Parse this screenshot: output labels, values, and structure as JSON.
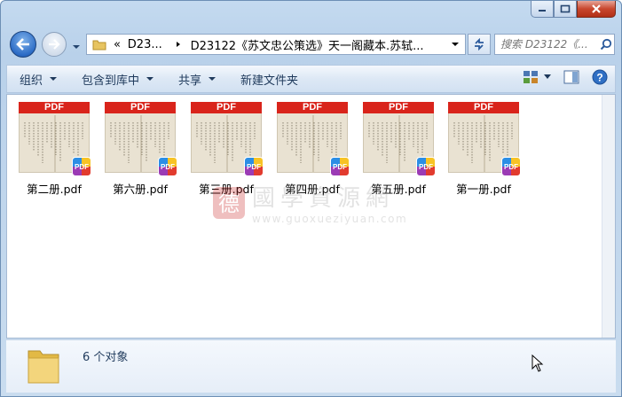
{
  "window": {
    "address_parts": [
      "«",
      "D23...",
      "D23122《苏文忠公策选》天一阁藏本.苏轼..."
    ],
    "search_placeholder": "搜索 D23122《...",
    "accent_color": "#2c6cc6"
  },
  "toolbar": {
    "organize": "组织",
    "include_library": "包含到库中",
    "share": "共享",
    "new_folder": "新建文件夹"
  },
  "files": [
    {
      "name": "第二册.pdf",
      "thumb_label": "PDF",
      "badge": "PDF"
    },
    {
      "name": "第六册.pdf",
      "thumb_label": "PDF",
      "badge": "PDF"
    },
    {
      "name": "第三册.pdf",
      "thumb_label": "PDF",
      "badge": "PDF"
    },
    {
      "name": "第四册.pdf",
      "thumb_label": "PDF",
      "badge": "PDF"
    },
    {
      "name": "第五册.pdf",
      "thumb_label": "PDF",
      "badge": "PDF"
    },
    {
      "name": "第一册.pdf",
      "thumb_label": "PDF",
      "badge": "PDF"
    }
  ],
  "watermark": {
    "logo_char": "德",
    "text": "國學資源網",
    "url": "www.guoxueziyuan.com"
  },
  "status": {
    "count_text": "6 个对象"
  }
}
